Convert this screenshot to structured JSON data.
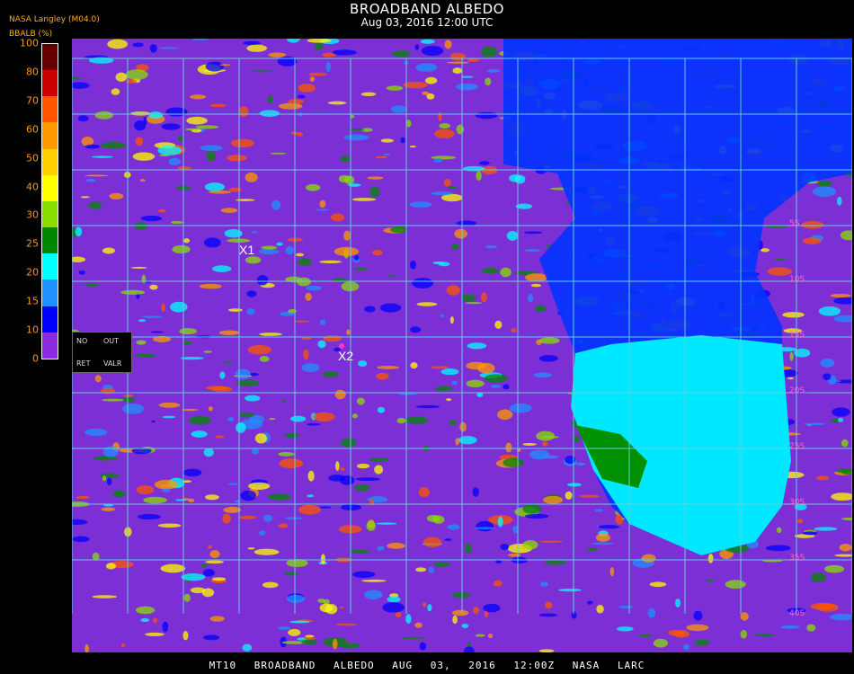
{
  "header": {
    "title": "BROADBAND ALBEDO",
    "datetime": "Aug 03, 2016 12:00 UTC",
    "source": "NASA Langley (M04.0)",
    "units_label": "BBALB (%)"
  },
  "colorbar": {
    "ticks": [
      "100",
      "80",
      "70",
      "60",
      "50",
      "40",
      "30",
      "25",
      "20",
      "15",
      "10",
      "0"
    ],
    "colors": [
      "#660000",
      "#cc0000",
      "#ff5500",
      "#ff9900",
      "#ffd000",
      "#ffff00",
      "#88dd00",
      "#008800",
      "#00ffff",
      "#1e90ff",
      "#0000ff",
      "#8a2be2"
    ],
    "nodata": {
      "no": "NO",
      "out": "OUT",
      "ret": "RET",
      "valr": "VALR"
    }
  },
  "map": {
    "markers": [
      {
        "id": "X1",
        "label": "X1"
      },
      {
        "id": "X2",
        "label": "X2"
      }
    ],
    "lat_labels": [
      "5S",
      "10S",
      "15S",
      "20S",
      "25S",
      "30S",
      "35S",
      "40S"
    ],
    "background_color": "#7b2fd4",
    "grid_color": "#66ccdd"
  },
  "footer": {
    "text": "MT10  BROADBAND ALBEDO  AUG 03, 2016 12:00Z  NASA LARC"
  }
}
